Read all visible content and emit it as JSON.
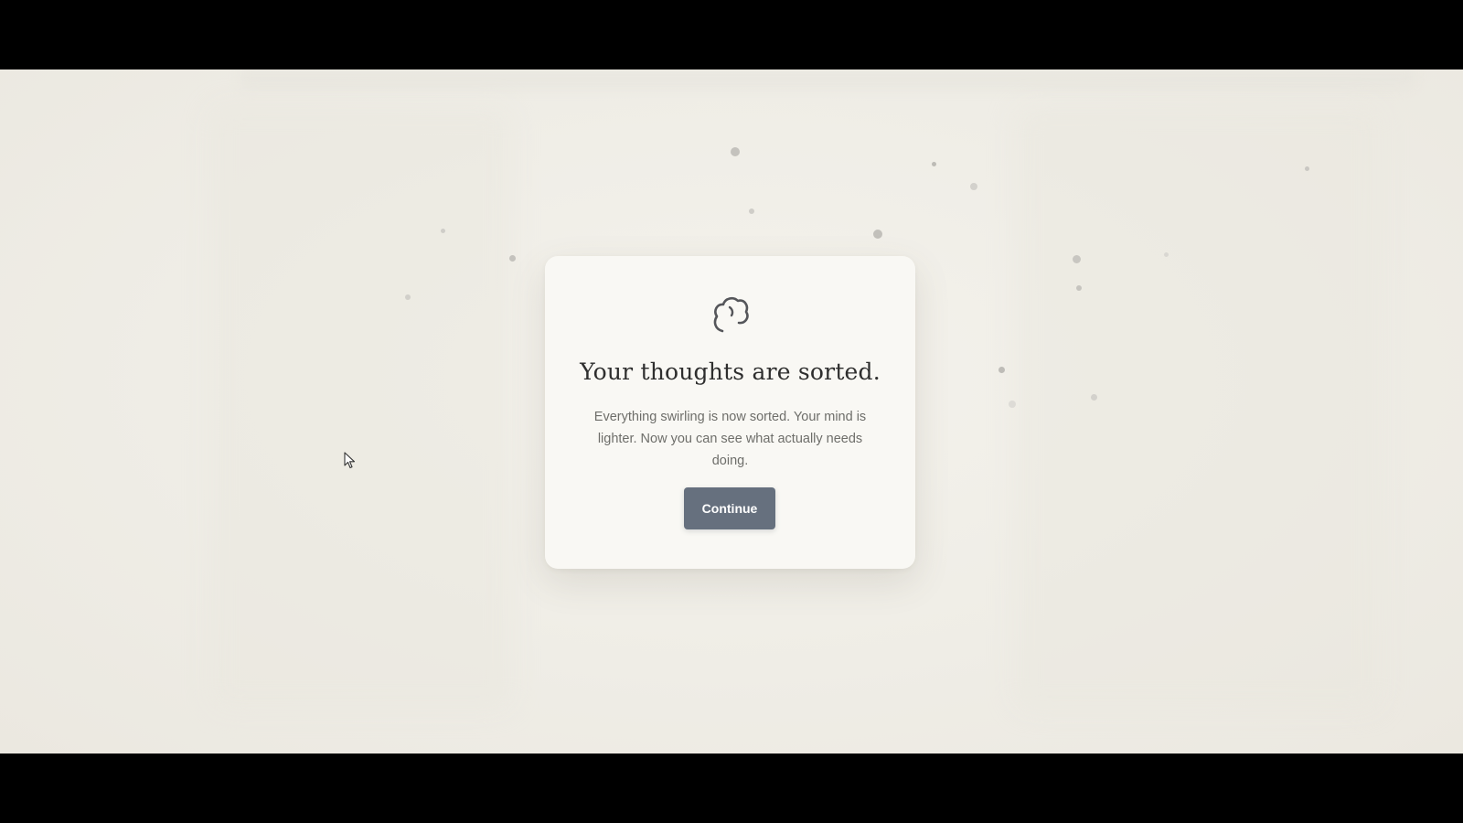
{
  "dialog": {
    "title": "Your thoughts are sorted.",
    "body": "Everything swirling is now sorted. Your mind is lighter. Now you can see what actually needs doing.",
    "continue_label": "Continue",
    "icon": "cloud-icon"
  },
  "colors": {
    "background": "#efede6",
    "card": "#f9f8f4",
    "button": "#66707e",
    "title": "#2e2e2e",
    "body_text": "#6e6e6a",
    "particle": "#c9c7c2"
  }
}
